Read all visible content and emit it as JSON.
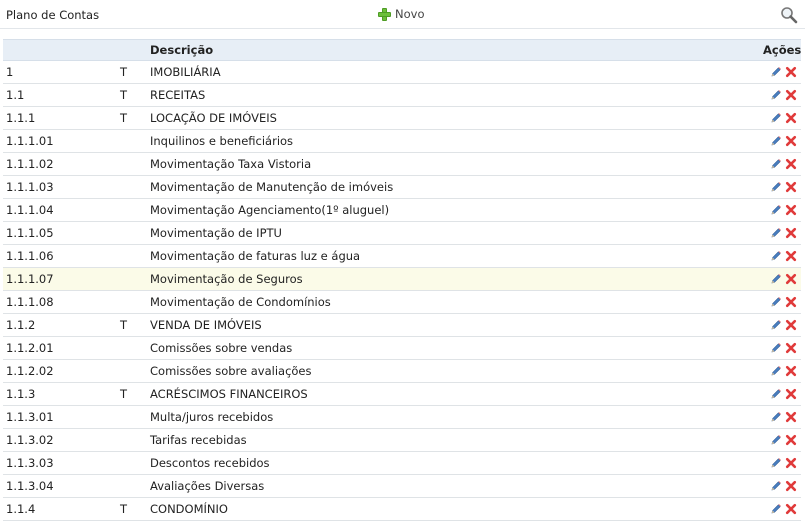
{
  "header": {
    "title": "Plano de Contas",
    "new_label": "Novo"
  },
  "table": {
    "columns": {
      "descricao": "Descrição",
      "acoes": "Ações"
    },
    "rows": [
      {
        "code": "1",
        "type": "T",
        "desc": "IMOBILIÁRIA"
      },
      {
        "code": "1.1",
        "type": "T",
        "desc": "RECEITAS"
      },
      {
        "code": "1.1.1",
        "type": "T",
        "desc": "LOCAÇÃO DE IMÓVEIS"
      },
      {
        "code": "1.1.1.01",
        "type": "",
        "desc": "Inquilinos e beneficiários"
      },
      {
        "code": "1.1.1.02",
        "type": "",
        "desc": "Movimentação Taxa Vistoria"
      },
      {
        "code": "1.1.1.03",
        "type": "",
        "desc": "Movimentação de Manutenção de imóveis"
      },
      {
        "code": "1.1.1.04",
        "type": "",
        "desc": "Movimentação Agenciamento(1º aluguel)"
      },
      {
        "code": "1.1.1.05",
        "type": "",
        "desc": "Movimentação de IPTU"
      },
      {
        "code": "1.1.1.06",
        "type": "",
        "desc": "Movimentação de faturas luz e água"
      },
      {
        "code": "1.1.1.07",
        "type": "",
        "desc": "Movimentação de Seguros",
        "highlighted": true
      },
      {
        "code": "1.1.1.08",
        "type": "",
        "desc": "Movimentação de Condomínios"
      },
      {
        "code": "1.1.2",
        "type": "T",
        "desc": "VENDA DE IMÓVEIS"
      },
      {
        "code": "1.1.2.01",
        "type": "",
        "desc": "Comissões sobre vendas"
      },
      {
        "code": "1.1.2.02",
        "type": "",
        "desc": "Comissões sobre avaliações"
      },
      {
        "code": "1.1.3",
        "type": "T",
        "desc": "ACRÉSCIMOS FINANCEIROS"
      },
      {
        "code": "1.1.3.01",
        "type": "",
        "desc": "Multa/juros recebidos"
      },
      {
        "code": "1.1.3.02",
        "type": "",
        "desc": "Tarifas recebidas"
      },
      {
        "code": "1.1.3.03",
        "type": "",
        "desc": "Descontos recebidos"
      },
      {
        "code": "1.1.3.04",
        "type": "",
        "desc": "Avaliações Diversas"
      },
      {
        "code": "1.1.4",
        "type": "T",
        "desc": "CONDOMÍNIO"
      }
    ]
  },
  "icons": {
    "new": "plus-icon",
    "search": "search-icon",
    "edit": "pencil-icon",
    "delete": "delete-x-icon"
  },
  "colors": {
    "header_bg": "#e7eef6",
    "highlight_row": "#fbfbe8",
    "plus_green": "#6cbf3b",
    "delete_red": "#e03a3a"
  }
}
